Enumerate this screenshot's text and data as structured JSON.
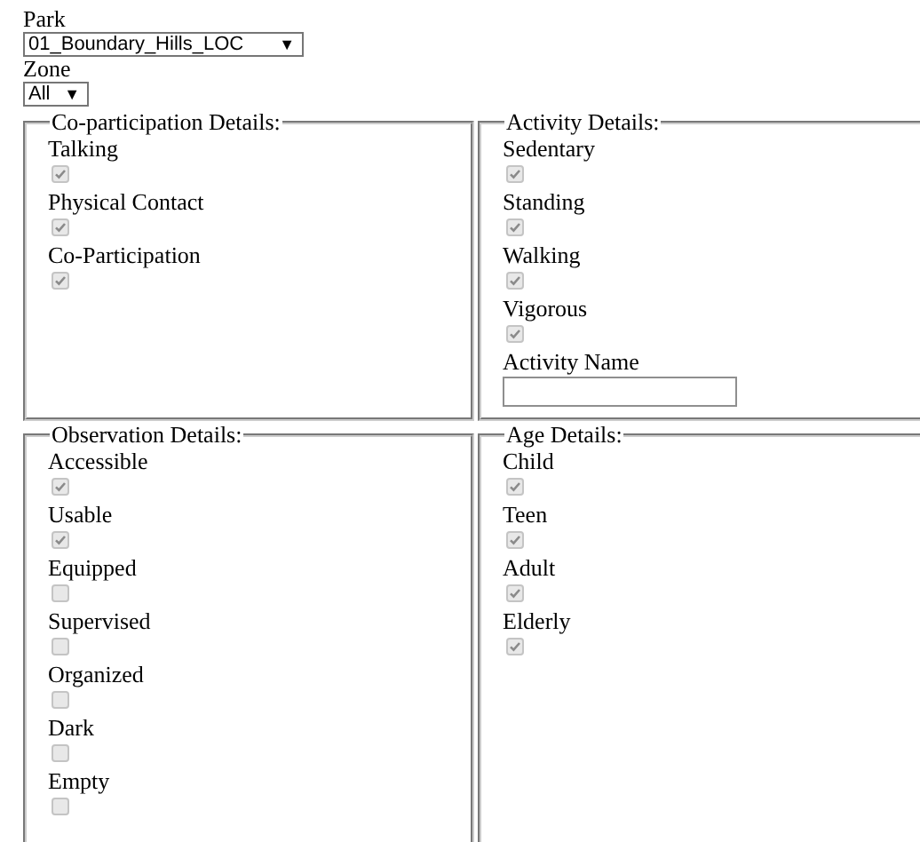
{
  "park": {
    "label": "Park",
    "value": "01_Boundary_Hills_LOC",
    "arrow": "▼"
  },
  "zone": {
    "label": "Zone",
    "value": "All",
    "arrow": "▼"
  },
  "groups": [
    {
      "legend": "Co-participation Details:",
      "items": [
        {
          "kind": "checkbox",
          "label": "Talking",
          "checked": true,
          "disabled": true
        },
        {
          "kind": "checkbox",
          "label": "Physical Contact",
          "checked": true,
          "disabled": true
        },
        {
          "kind": "checkbox",
          "label": "Co-Participation",
          "checked": true,
          "disabled": true
        }
      ]
    },
    {
      "legend": "Activity Details:",
      "items": [
        {
          "kind": "checkbox",
          "label": "Sedentary",
          "checked": true,
          "disabled": true
        },
        {
          "kind": "checkbox",
          "label": "Standing",
          "checked": true,
          "disabled": true
        },
        {
          "kind": "checkbox",
          "label": "Walking",
          "checked": true,
          "disabled": true
        },
        {
          "kind": "checkbox",
          "label": "Vigorous",
          "checked": true,
          "disabled": true
        },
        {
          "kind": "text",
          "label": "Activity Name"
        }
      ]
    },
    {
      "legend": "Observation Details:",
      "items": [
        {
          "kind": "checkbox",
          "label": "Accessible",
          "checked": true,
          "disabled": true
        },
        {
          "kind": "checkbox",
          "label": "Usable",
          "checked": true,
          "disabled": true
        },
        {
          "kind": "checkbox",
          "label": "Equipped",
          "checked": false,
          "disabled": true
        },
        {
          "kind": "checkbox",
          "label": "Supervised",
          "checked": false,
          "disabled": true
        },
        {
          "kind": "checkbox",
          "label": "Organized",
          "checked": false,
          "disabled": true
        },
        {
          "kind": "checkbox",
          "label": "Dark",
          "checked": false,
          "disabled": true
        },
        {
          "kind": "checkbox",
          "label": "Empty",
          "checked": false,
          "disabled": true
        }
      ]
    },
    {
      "legend": "Age Details:",
      "items": [
        {
          "kind": "checkbox",
          "label": "Child",
          "checked": true,
          "disabled": true
        },
        {
          "kind": "checkbox",
          "label": "Teen",
          "checked": true,
          "disabled": true
        },
        {
          "kind": "checkbox",
          "label": "Adult",
          "checked": true,
          "disabled": true
        },
        {
          "kind": "checkbox",
          "label": "Elderly",
          "checked": true,
          "disabled": true
        }
      ]
    }
  ]
}
